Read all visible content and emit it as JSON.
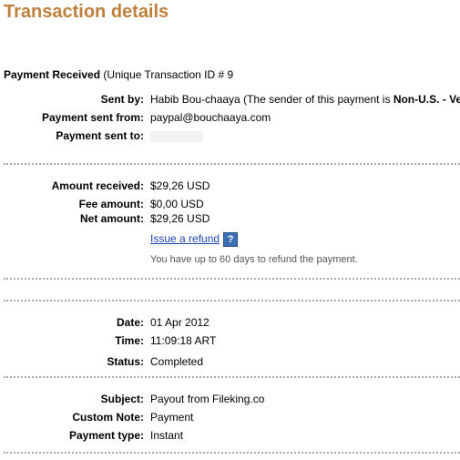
{
  "header": {
    "title": "Transaction details"
  },
  "payment": {
    "heading": "Payment Received",
    "heading_suffix": "(Unique Transaction ID # 9",
    "sent_by_label": "Sent by:",
    "sent_by_name": "Habib Bou-chaaya (The sender of this payment is ",
    "sent_by_status": "Non-U.S. - Ve",
    "sent_from_label": "Payment sent from:",
    "sent_from_value": "paypal@bouchaaya.com",
    "sent_to_label": "Payment sent to:"
  },
  "amounts": {
    "received_label": "Amount received:",
    "received_value": "$29,26 USD",
    "fee_label": "Fee amount:",
    "fee_value": "$0,00 USD",
    "net_label": "Net amount:",
    "net_value": "$29,26 USD",
    "refund_link": "Issue a refund",
    "help_icon_glyph": "?",
    "refund_note": "You have up to 60 days to refund the payment."
  },
  "timing": {
    "date_label": "Date:",
    "date_value": "01 Apr 2012",
    "time_label": "Time:",
    "time_value": "11:09:18 ART",
    "status_label": "Status:",
    "status_value": "Completed"
  },
  "details": {
    "subject_label": "Subject:",
    "subject_value": "Payout from Fileking.co",
    "note_label": "Custom Note:",
    "note_value": "Payment",
    "type_label": "Payment type:",
    "type_value": "Instant"
  },
  "colors": {
    "title": "#c0803b",
    "link": "#1e46b4",
    "divider": "#a7a7a7"
  }
}
